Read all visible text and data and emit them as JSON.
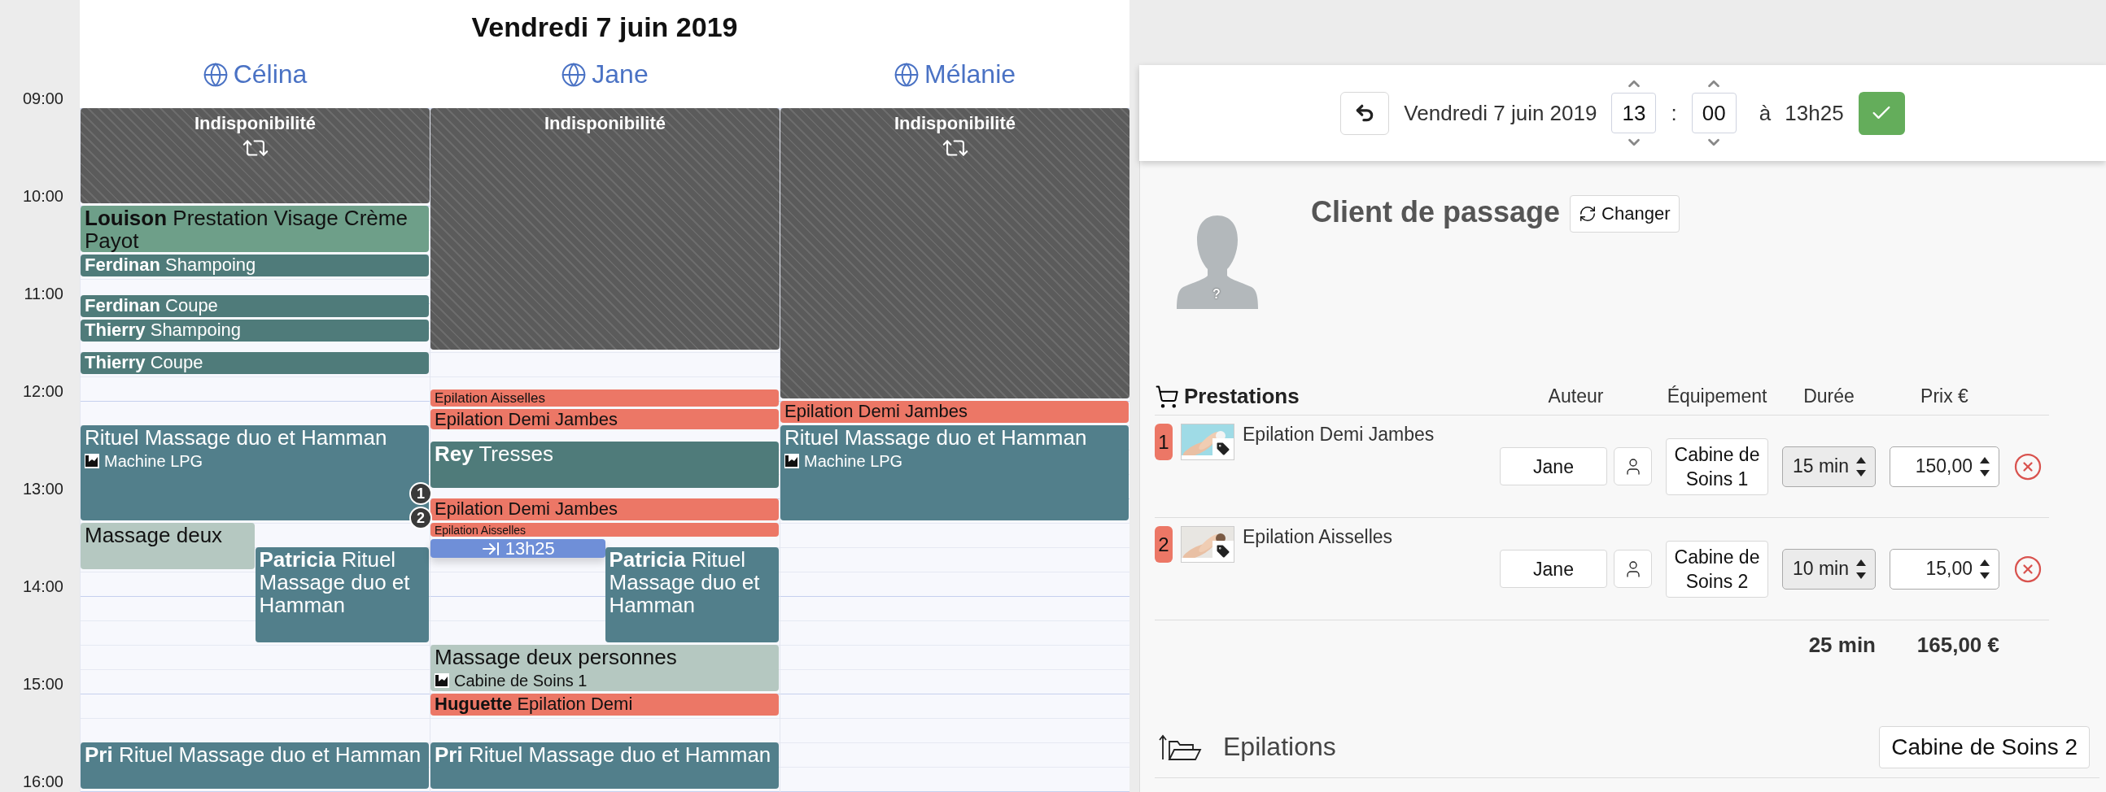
{
  "calendar": {
    "title": "Vendredi 7 juin 2019",
    "hours": [
      "09:00",
      "10:00",
      "11:00",
      "12:00",
      "13:00",
      "14:00",
      "15:00",
      "16:00"
    ],
    "columns": [
      {
        "name": "Célina",
        "events": [
          {
            "kind": "unavailable",
            "text": "Indisponibilité",
            "recurring": true
          },
          {
            "kind": "appointment",
            "text": "**Louison** Prestation Visage Crème Payot",
            "color": "#6e9f89"
          },
          {
            "kind": "appointment",
            "text": "**Ferdinan** Shampoing",
            "color": "#4f7b7a"
          },
          {
            "kind": "appointment",
            "text": "**Ferdinan** Coupe",
            "color": "#4f7b7a"
          },
          {
            "kind": "appointment",
            "text": "**Thierry** Shampoing",
            "color": "#4f7b7a"
          },
          {
            "kind": "appointment",
            "text": "**Thierry** Coupe",
            "color": "#4f7b7a"
          },
          {
            "kind": "appointment",
            "text": "Rituel Massage duo et Hamman",
            "equipment": "Machine LPG",
            "color": "#527f8b"
          },
          {
            "kind": "appointment",
            "text": "Massage deux",
            "color": "#b5c8c1"
          },
          {
            "kind": "appointment",
            "text": "**Patricia** Rituel Massage duo et Hamman",
            "color": "#527f8b"
          },
          {
            "kind": "appointment",
            "text": "**Pri** Rituel Massage duo et Hamman",
            "color": "#527f8b"
          }
        ]
      },
      {
        "name": "Jane",
        "events": [
          {
            "kind": "unavailable",
            "text": "Indisponibilité",
            "recurring": false
          },
          {
            "kind": "appointment",
            "text": "Epilation Aisselles",
            "color": "#ec7766"
          },
          {
            "kind": "appointment",
            "text": "Epilation Demi Jambes",
            "color": "#ec7766"
          },
          {
            "kind": "appointment",
            "text": "**Rey** Tresses",
            "color": "#4f7b7a"
          },
          {
            "kind": "appointment",
            "text": "Epilation Demi Jambes",
            "color": "#ec7766",
            "badge": "1"
          },
          {
            "kind": "appointment",
            "text": "Epilation Aisselles",
            "color": "#ec7766",
            "badge": "2"
          },
          {
            "kind": "end-marker",
            "text": "13h25"
          },
          {
            "kind": "appointment",
            "text": "**Patricia** Rituel Massage duo et Hamman",
            "color": "#527f8b"
          },
          {
            "kind": "appointment",
            "text": "Massage deux personnes",
            "equipment": "Cabine de Soins 1",
            "color": "#b5c8c1"
          },
          {
            "kind": "appointment",
            "text": "**Huguette** Epilation Demi",
            "color": "#ec7766"
          },
          {
            "kind": "appointment",
            "text": "**Pri** Rituel Massage duo et Hamman",
            "color": "#527f8b"
          }
        ]
      },
      {
        "name": "Mélanie",
        "events": [
          {
            "kind": "unavailable",
            "text": "Indisponibilité",
            "recurring": true
          },
          {
            "kind": "appointment",
            "text": "Epilation Demi Jambes",
            "color": "#ec7766"
          },
          {
            "kind": "appointment",
            "text": "Rituel Massage duo et Hamman",
            "equipment": "Machine LPG",
            "color": "#527f8b"
          }
        ]
      }
    ]
  },
  "editor": {
    "toolbar": {
      "date": "Vendredi 7 juin 2019",
      "hour": "13",
      "separator": ":",
      "minute": "00",
      "end": "à 13h25"
    },
    "client": {
      "name": "Client de passage",
      "change_label": "Changer",
      "avatar_mark": "?"
    },
    "services": {
      "title": "Prestations",
      "columns": [
        "Auteur",
        "Équipement",
        "Durée",
        "Prix €"
      ],
      "rows": [
        {
          "number": "1",
          "name": "Epilation Demi Jambes",
          "author": "Jane",
          "equipment": "Cabine de Soins 1",
          "duration": "15 min",
          "price": "150,00"
        },
        {
          "number": "2",
          "name": "Epilation Aisselles",
          "author": "Jane",
          "equipment": "Cabine de Soins 2",
          "duration": "10 min",
          "price": "15,00"
        }
      ],
      "total_duration": "25 min",
      "total_price": "165,00 €"
    },
    "category": {
      "name": "Epilations",
      "equipment": "Cabine de Soins 2"
    }
  }
}
